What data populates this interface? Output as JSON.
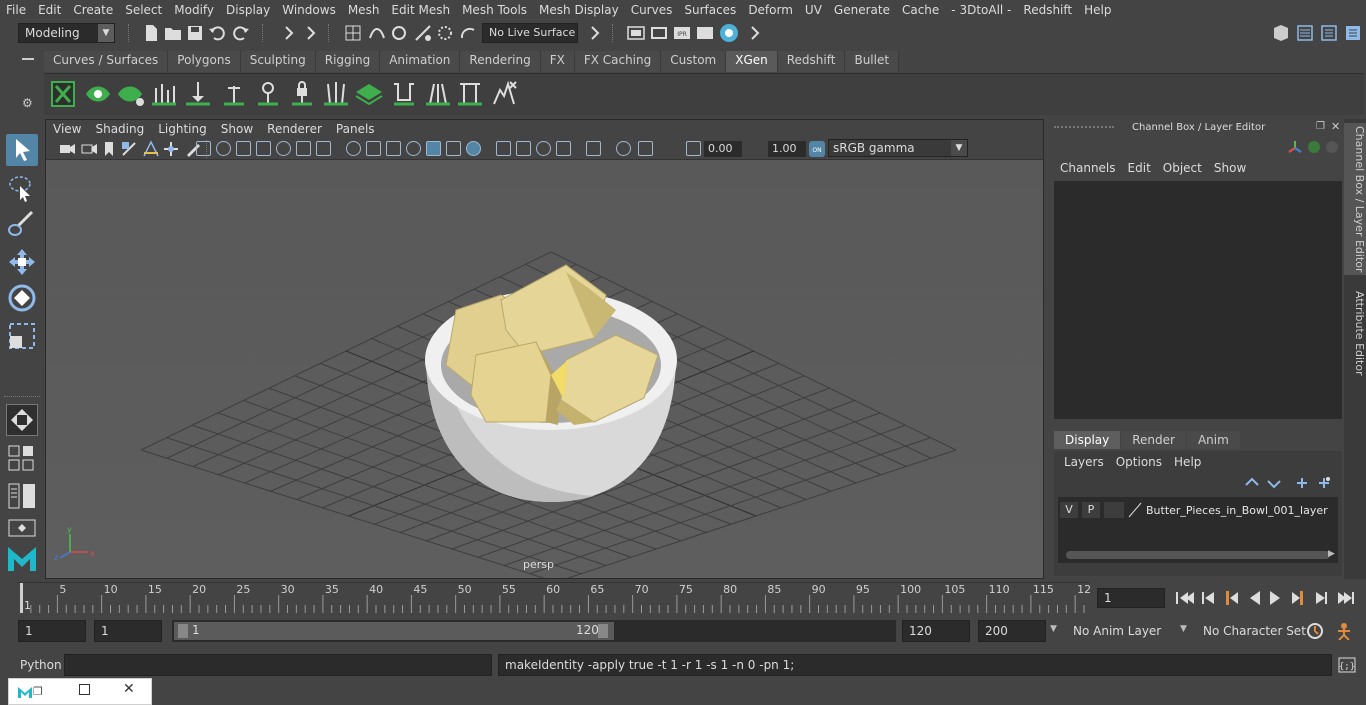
{
  "menubar": [
    "File",
    "Edit",
    "Create",
    "Select",
    "Modify",
    "Display",
    "Windows",
    "Mesh",
    "Edit Mesh",
    "Mesh Tools",
    "Mesh Display",
    "Curves",
    "Surfaces",
    "Deform",
    "UV",
    "Generate",
    "Cache",
    "- 3DtoAll -",
    "Redshift",
    "Help"
  ],
  "status": {
    "mode": "Modeling",
    "live_surface": "No Live Surface"
  },
  "shelf_tabs": [
    "Curves / Surfaces",
    "Polygons",
    "Sculpting",
    "Rigging",
    "Animation",
    "Rendering",
    "FX",
    "FX Caching",
    "Custom",
    "XGen",
    "Redshift",
    "Bullet"
  ],
  "active_shelf": "XGen",
  "viewport": {
    "menu": [
      "View",
      "Shading",
      "Lighting",
      "Show",
      "Renderer",
      "Panels"
    ],
    "exposure": "0.00",
    "gamma": "1.00",
    "color_space": "sRGB gamma",
    "camera_label": "persp"
  },
  "channel_box": {
    "title": "Channel Box / Layer Editor",
    "menu": [
      "Channels",
      "Edit",
      "Object",
      "Show"
    ],
    "layer_tabs": [
      "Display",
      "Render",
      "Anim"
    ],
    "active_layer_tab": "Display",
    "layer_menu": [
      "Layers",
      "Options",
      "Help"
    ],
    "layer": {
      "v": "V",
      "p": "P",
      "name": "Butter_Pieces_in_Bowl_001_layer"
    }
  },
  "side_tabs": [
    "Channel Box / Layer Editor",
    "Attribute Editor"
  ],
  "timeline": {
    "ticks": [
      "5",
      "10",
      "15",
      "20",
      "25",
      "30",
      "35",
      "40",
      "45",
      "50",
      "55",
      "60",
      "65",
      "70",
      "75",
      "80",
      "85",
      "90",
      "95",
      "100",
      "105",
      "110",
      "115",
      "12"
    ],
    "start_marker": "1",
    "current_frame": "1"
  },
  "range": {
    "start": "1",
    "playback_start": "1",
    "slider_start": "1",
    "slider_end": "120",
    "playback_end": "120",
    "end": "200",
    "anim_layer": "No Anim Layer",
    "character_set": "No Character Set"
  },
  "cmd": {
    "label": "Python",
    "result": "makeIdentity -apply true -t 1 -r 1 -s 1 -n 0 -pn 1;"
  },
  "colors": {
    "bg": "#444444",
    "accent": "#5285a6",
    "shelf_green": "#3fae4c",
    "butter": "#e0cf8f"
  }
}
